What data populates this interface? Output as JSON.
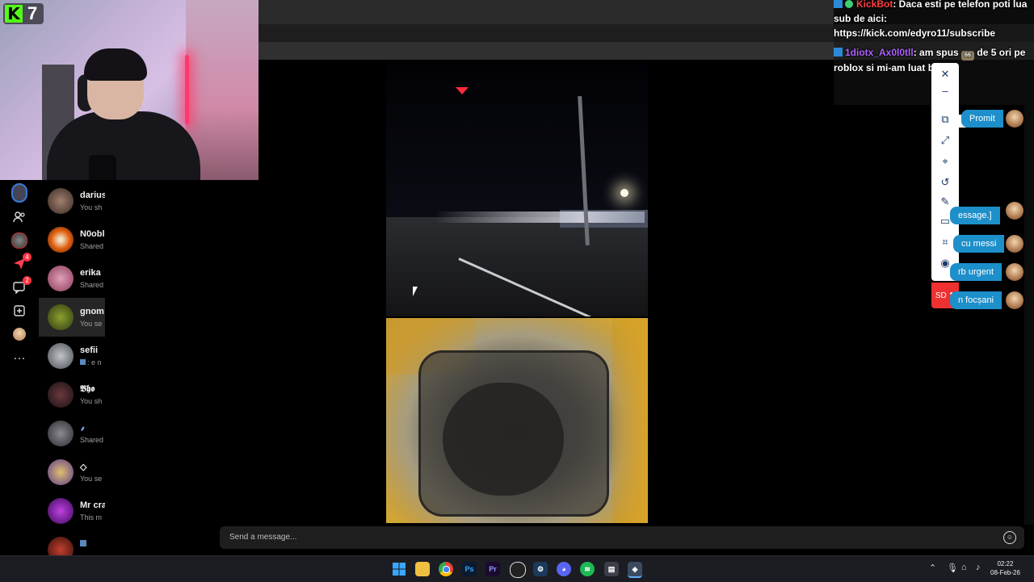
{
  "stream": {
    "badge_number": "7"
  },
  "chat": {
    "messages": [
      {
        "user": "KickBot",
        "text": ": Daca esti pe telefon poti lua sub de aici: https://kick.com/edyro11/subscribe",
        "user_color": "#ff4040"
      },
      {
        "user": "1diotx_Ax0l0tll",
        "text_before": ": am spus",
        "emote": "66",
        "text_after": "de 5 ori pe roblox si mi-am luat ban",
        "user_color": "#a050ff"
      }
    ]
  },
  "dms": [
    {
      "name": "darius",
      "preview": "You sh"
    },
    {
      "name": "N0obl",
      "preview": "Shared"
    },
    {
      "name": "erika",
      "preview": "Shared"
    },
    {
      "name": "gnom",
      "preview": "You se"
    },
    {
      "name": "sefii",
      "preview": ": e n"
    },
    {
      "name": "𝕭𝖍𝖔",
      "preview": "You sh"
    },
    {
      "name": "",
      "preview": "Shared"
    },
    {
      "name": "◇",
      "preview": "You se"
    },
    {
      "name": "Mr cra",
      "preview": "This m"
    }
  ],
  "rail_badges": {
    "send": "4",
    "messages": "2"
  },
  "toolbar": {
    "sd_label": "SD"
  },
  "bubbles": [
    "Promit",
    "essage.]",
    "cu messi",
    "rb urgent",
    "n focșani"
  ],
  "input": {
    "placeholder": "Send a message..."
  },
  "taskbar": {
    "apps": [
      "windows-start",
      "file-explorer",
      "chrome",
      "photoshop",
      "premiere",
      "obs",
      "steam",
      "discord",
      "spotify",
      "terminal",
      "app-active"
    ],
    "ps_label": "Ps",
    "pr_label": "Pr",
    "time": "02:22",
    "date": "08-Feb-26"
  },
  "colors": {
    "accent": "#1d8fca",
    "kick_green": "#53fc18",
    "sd_red": "#ee3030"
  }
}
